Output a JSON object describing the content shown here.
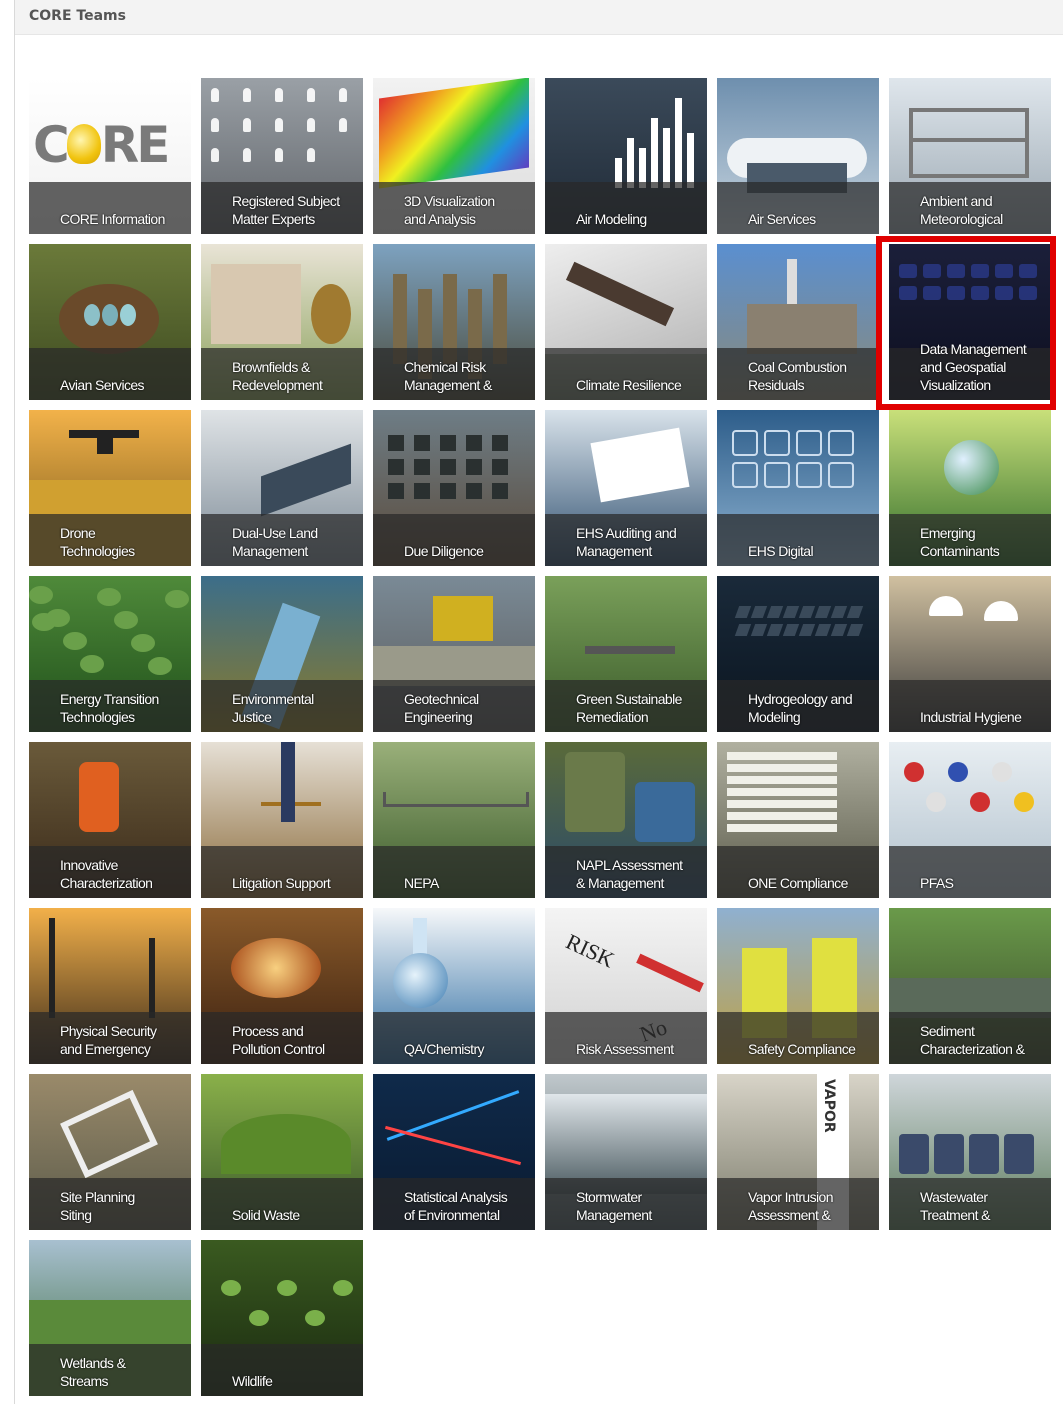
{
  "header": {
    "title": "CORE Teams"
  },
  "logo": {
    "c": "C",
    "re": "RE"
  },
  "tiles": [
    {
      "label": "CORE Information",
      "bg": [
        "#ffffff",
        "#f0f0f0"
      ],
      "motif": "logo"
    },
    {
      "label": "Registered Subject\nMatter Experts",
      "bg": [
        "#9aa0a6",
        "#5f6368"
      ],
      "motif": "network"
    },
    {
      "label": "3D Visualization\nand Analysis",
      "bg": [
        "#f2f2f2",
        "#dcdcdc"
      ],
      "motif": "rainbow"
    },
    {
      "label": "Air Modeling",
      "bg": [
        "#3b4a5a",
        "#1f2a36"
      ],
      "motif": "bars"
    },
    {
      "label": "Air Services",
      "bg": [
        "#6e8fae",
        "#c9d6e0"
      ],
      "motif": "clouds"
    },
    {
      "label": "Ambient and\nMeteorological",
      "bg": [
        "#dfe6ec",
        "#9aa7b1"
      ],
      "motif": "frame"
    },
    {
      "label": "Avian Services",
      "bg": [
        "#6b7a3a",
        "#3d4a20"
      ],
      "motif": "nest"
    },
    {
      "label": "Brownfields &\nRedevelopment",
      "bg": [
        "#e9e4d6",
        "#8aa05a"
      ],
      "motif": "buildings"
    },
    {
      "label": "Chemical Risk\nManagement &",
      "bg": [
        "#7da2c0",
        "#4a4a3a"
      ],
      "motif": "refinery"
    },
    {
      "label": "Climate Resilience",
      "bg": [
        "#d9d9d9",
        "#6f7b6a"
      ],
      "motif": "snow"
    },
    {
      "label": "Coal Combustion\nResiduals",
      "bg": [
        "#5a8fd0",
        "#8a8a7a"
      ],
      "motif": "plant"
    },
    {
      "label": "Data Management\nand Geospatial\nVisualization",
      "bg": [
        "#1b1f3a",
        "#0d0f1f"
      ],
      "motif": "keys"
    },
    {
      "label": "Drone\nTechnologies",
      "bg": [
        "#f2b24a",
        "#7a5a1a"
      ],
      "motif": "drone"
    },
    {
      "label": "Dual-Use Land\nManagement",
      "bg": [
        "#dfe3e6",
        "#7c8a96"
      ],
      "motif": "solar"
    },
    {
      "label": "Due Diligence",
      "bg": [
        "#6e7d86",
        "#5a4a3a"
      ],
      "motif": "factory"
    },
    {
      "label": "EHS Auditing and\nManagement",
      "bg": [
        "#d8e2ea",
        "#2f4f6f"
      ],
      "motif": "docs"
    },
    {
      "label": "EHS Digital",
      "bg": [
        "#2d5d8a",
        "#8fb3d1"
      ],
      "motif": "icons"
    },
    {
      "label": "Emerging\nContaminants",
      "bg": [
        "#c9e07a",
        "#2f6b2a"
      ],
      "motif": "globe"
    },
    {
      "label": "Energy Transition\nTechnologies",
      "bg": [
        "#4f8a3a",
        "#1f4f1a"
      ],
      "motif": "leaves"
    },
    {
      "label": "Environmental\nJustice",
      "bg": [
        "#3c6e8a",
        "#8a7a2a"
      ],
      "motif": "river"
    },
    {
      "label": "Geotechnical\nEngineering",
      "bg": [
        "#7a8a96",
        "#5a5a5a"
      ],
      "motif": "bulldozer"
    },
    {
      "label": "Green Sustainable\nRemediation",
      "bg": [
        "#7aa05a",
        "#3a5a2a"
      ],
      "motif": "grass"
    },
    {
      "label": "Hydrogeology and\nModeling",
      "bg": [
        "#1a2a3a",
        "#0a141f"
      ],
      "motif": "keyboard"
    },
    {
      "label": "Industrial Hygiene",
      "bg": [
        "#d0c0a0",
        "#3a3a3a"
      ],
      "motif": "workers"
    },
    {
      "label": "Innovative\nCharacterization",
      "bg": [
        "#6a5a3a",
        "#3a2a1a"
      ],
      "motif": "field"
    },
    {
      "label": "Litigation Support",
      "bg": [
        "#e6e0d6",
        "#8a6a3a"
      ],
      "motif": "scales"
    },
    {
      "label": "NEPA",
      "bg": [
        "#9ab07a",
        "#3a5a2a"
      ],
      "motif": "bridge"
    },
    {
      "label": "NAPL Assessment\n& Management",
      "bg": [
        "#5a6a3a",
        "#2a4a6a"
      ],
      "motif": "barrels"
    },
    {
      "label": "ONE Compliance",
      "bg": [
        "#b0b0a0",
        "#5a5a4a"
      ],
      "motif": "papers"
    },
    {
      "label": "PFAS",
      "bg": [
        "#e8eef2",
        "#b0c0cc"
      ],
      "motif": "molecule"
    },
    {
      "label": "Physical Security\nand Emergency",
      "bg": [
        "#f2b04a",
        "#3a2a1a"
      ],
      "motif": "pylons"
    },
    {
      "label": "Process and\nPollution Control",
      "bg": [
        "#8a5a2a",
        "#3a2010"
      ],
      "motif": "furnace"
    },
    {
      "label": "QA/Chemistry",
      "bg": [
        "#f6f8fa",
        "#2a6aa0"
      ],
      "motif": "flask"
    },
    {
      "label": "Risk Assessment",
      "bg": [
        "#f4f4f4",
        "#d0d0d0"
      ],
      "motif": "risk"
    },
    {
      "label": "Safety Compliance",
      "bg": [
        "#8fb0d0",
        "#c0a040"
      ],
      "motif": "vests"
    },
    {
      "label": "Sediment\nCharacterization &",
      "bg": [
        "#6a9a4a",
        "#3a4a2a"
      ],
      "motif": "stream"
    },
    {
      "label": "Site Planning\nSiting",
      "bg": [
        "#9a8a6a",
        "#5a5a4a"
      ],
      "motif": "aerial"
    },
    {
      "label": "Solid Waste",
      "bg": [
        "#8ab04a",
        "#3a5a2a"
      ],
      "motif": "landfill"
    },
    {
      "label": "Statistical Analysis\nof Environmental",
      "bg": [
        "#0f2a4a",
        "#0a1a30"
      ],
      "motif": "stocks"
    },
    {
      "label": "Stormwater\nManagement",
      "bg": [
        "#c0c8cc",
        "#4a5a60"
      ],
      "motif": "water"
    },
    {
      "label": "Vapor Intrusion\nAssessment &",
      "bg": [
        "#d8d4c8",
        "#7a7a6a"
      ],
      "motif": "vapor"
    },
    {
      "label": "Wastewater\nTreatment &",
      "bg": [
        "#cfd6da",
        "#5a7a5a"
      ],
      "motif": "tanks"
    },
    {
      "label": "Wetlands &\nStreams",
      "bg": [
        "#a8c0d0",
        "#3a6a3a"
      ],
      "motif": "wetland"
    },
    {
      "label": "Wildlife",
      "bg": [
        "#3a5a20",
        "#1a2a10"
      ],
      "motif": "sprouts"
    }
  ],
  "highlighted_tile": "Data Management\nand Geospatial\nVisualization",
  "vapor_text": "VAPOR",
  "risk_text": "RISK",
  "no_text": "No"
}
